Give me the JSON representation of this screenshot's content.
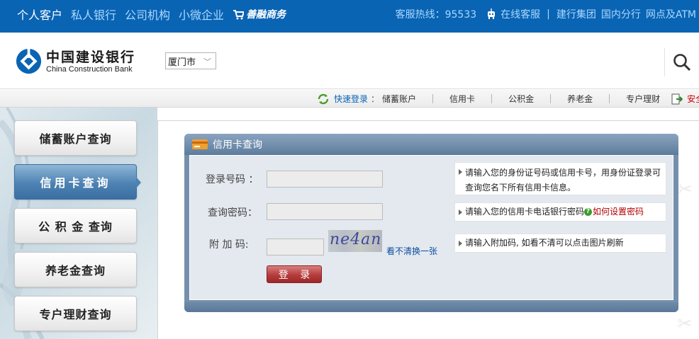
{
  "top_nav": {
    "items": [
      "个人客户",
      "私人银行",
      "公司机构",
      "小微企业"
    ],
    "shop_label": "善融商务",
    "hotline": "客服热线：95533",
    "online_service": "在线客服",
    "links": [
      "建行集团",
      "国内分行",
      "网点及ATM"
    ]
  },
  "brand": {
    "name_cn": "中国建设银行",
    "name_en": "China Construction Bank",
    "city": "厦门市"
  },
  "menubar": {
    "quick_login": "快速登录",
    "colon": "：",
    "items": [
      "储蓄账户",
      "信用卡",
      "公积金",
      "养老金",
      "专户理财"
    ],
    "safe_exit": "安全关闭"
  },
  "sidebar": {
    "items": [
      {
        "label": "储蓄账户查询",
        "active": false
      },
      {
        "label": "信用卡查询",
        "active": true
      },
      {
        "label": "公 积 金 查询",
        "active": false
      },
      {
        "label": "养老金查询",
        "active": false
      },
      {
        "label": "专户理财查询",
        "active": false
      }
    ]
  },
  "panel": {
    "title": "信用卡查询",
    "fields": {
      "login_label": "登录号码 ：",
      "password_label": "查询密码：",
      "captcha_label": "附 加 码:"
    },
    "captcha_text": "ne4an",
    "refresh_link": "看不清换一张",
    "hints": {
      "login": "请输入您的身份证号码或信用卡号，用身份证登录可查询您名下所有信用卡信息。",
      "password": "请输入您的信用卡电话银行密码",
      "password_link": "如何设置密码",
      "captcha": "请输入附加码, 如看不清可以点击图片刷新"
    },
    "login_button": "登 录"
  },
  "colors": {
    "top_bar": "#0a64b4",
    "active_tab": "#4d82b3",
    "panel_header": "#5d7c9c",
    "login_button": "#b63c3c",
    "link_red": "#b00000"
  }
}
